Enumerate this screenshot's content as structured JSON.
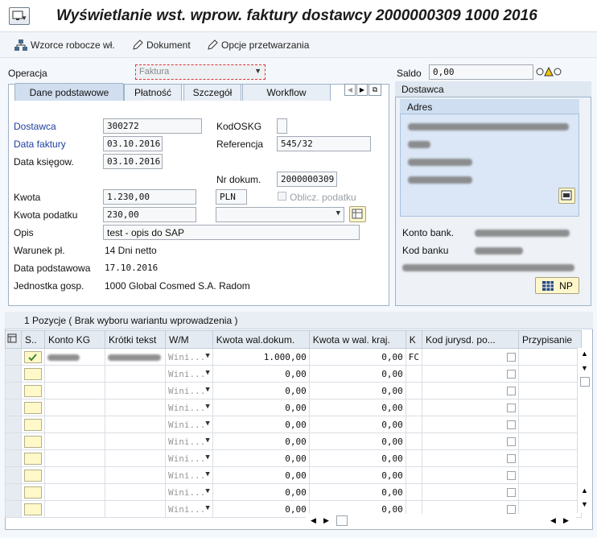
{
  "title": "Wyświetlanie wst. wprow. faktury dostawcy 2000000309 1000 2016",
  "toolbar": {
    "drafts": "Wzorce robocze wł.",
    "document": "Dokument",
    "options": "Opcje przetwarzania"
  },
  "operation": {
    "label": "Operacja",
    "value": "Faktura"
  },
  "balance": {
    "label": "Saldo",
    "value": "0,00"
  },
  "tabs": [
    "Dane podstawowe",
    "Płatność",
    "Szczegół",
    "Workflow"
  ],
  "form": {
    "vendor_label": "Dostawca",
    "vendor_value": "300272",
    "invoice_date_label": "Data faktury",
    "invoice_date_value": "03.10.2016",
    "posting_date_label": "Data księgow.",
    "posting_date_value": "03.10.2016",
    "kodoskg_label": "KodOSKG",
    "reference_label": "Referencja",
    "reference_value": "545/32",
    "doc_no_label": "Nr dokum.",
    "doc_no_value": "2000000309",
    "amount_label": "Kwota",
    "amount_value": "1.230,00",
    "currency": "PLN",
    "calc_tax_label": "Oblicz. podatku",
    "tax_label": "Kwota podatku",
    "tax_value": "230,00",
    "text_label": "Opis",
    "text_value": "test - opis do SAP",
    "payterms_label": "Warunek pł.",
    "payterms_value": "14 Dni netto",
    "baseline_label": "Data podstawowa",
    "baseline_value": "17.10.2016",
    "bizplace_label": "Jednostka gosp.",
    "bizplace_value": "1000 Global Cosmed S.A. Radom"
  },
  "vendor_panel": {
    "header": "Dostawca",
    "address_header": "Adres",
    "bank_account_label": "Konto bank.",
    "bank_key_label": "Kod banku",
    "np_button": "NP"
  },
  "grid": {
    "caption": "1 Pozycje ( Brak wyboru wariantu wprowadzenia )",
    "columns": [
      "S..",
      "Konto KG",
      "Krótki tekst",
      "W/M",
      "Kwota wal.dokum.",
      "Kwota w wal. kraj.",
      "K",
      "Kod jurysd. po...",
      "Przypisanie"
    ],
    "rows": [
      {
        "dc": "Wini...",
        "amt_doc": "1.000,00",
        "amt_loc": "0,00",
        "k": "FC"
      },
      {
        "dc": "Wini...",
        "amt_doc": "0,00",
        "amt_loc": "0,00",
        "k": ""
      },
      {
        "dc": "Wini...",
        "amt_doc": "0,00",
        "amt_loc": "0,00",
        "k": ""
      },
      {
        "dc": "Wini...",
        "amt_doc": "0,00",
        "amt_loc": "0,00",
        "k": ""
      },
      {
        "dc": "Wini...",
        "amt_doc": "0,00",
        "amt_loc": "0,00",
        "k": ""
      },
      {
        "dc": "Wini...",
        "amt_doc": "0,00",
        "amt_loc": "0,00",
        "k": ""
      },
      {
        "dc": "Wini...",
        "amt_doc": "0,00",
        "amt_loc": "0,00",
        "k": ""
      },
      {
        "dc": "Wini...",
        "amt_doc": "0,00",
        "amt_loc": "0,00",
        "k": ""
      },
      {
        "dc": "Wini...",
        "amt_doc": "0,00",
        "amt_loc": "0,00",
        "k": ""
      },
      {
        "dc": "Wini...",
        "amt_doc": "0,00",
        "amt_loc": "0,00",
        "k": ""
      }
    ]
  }
}
